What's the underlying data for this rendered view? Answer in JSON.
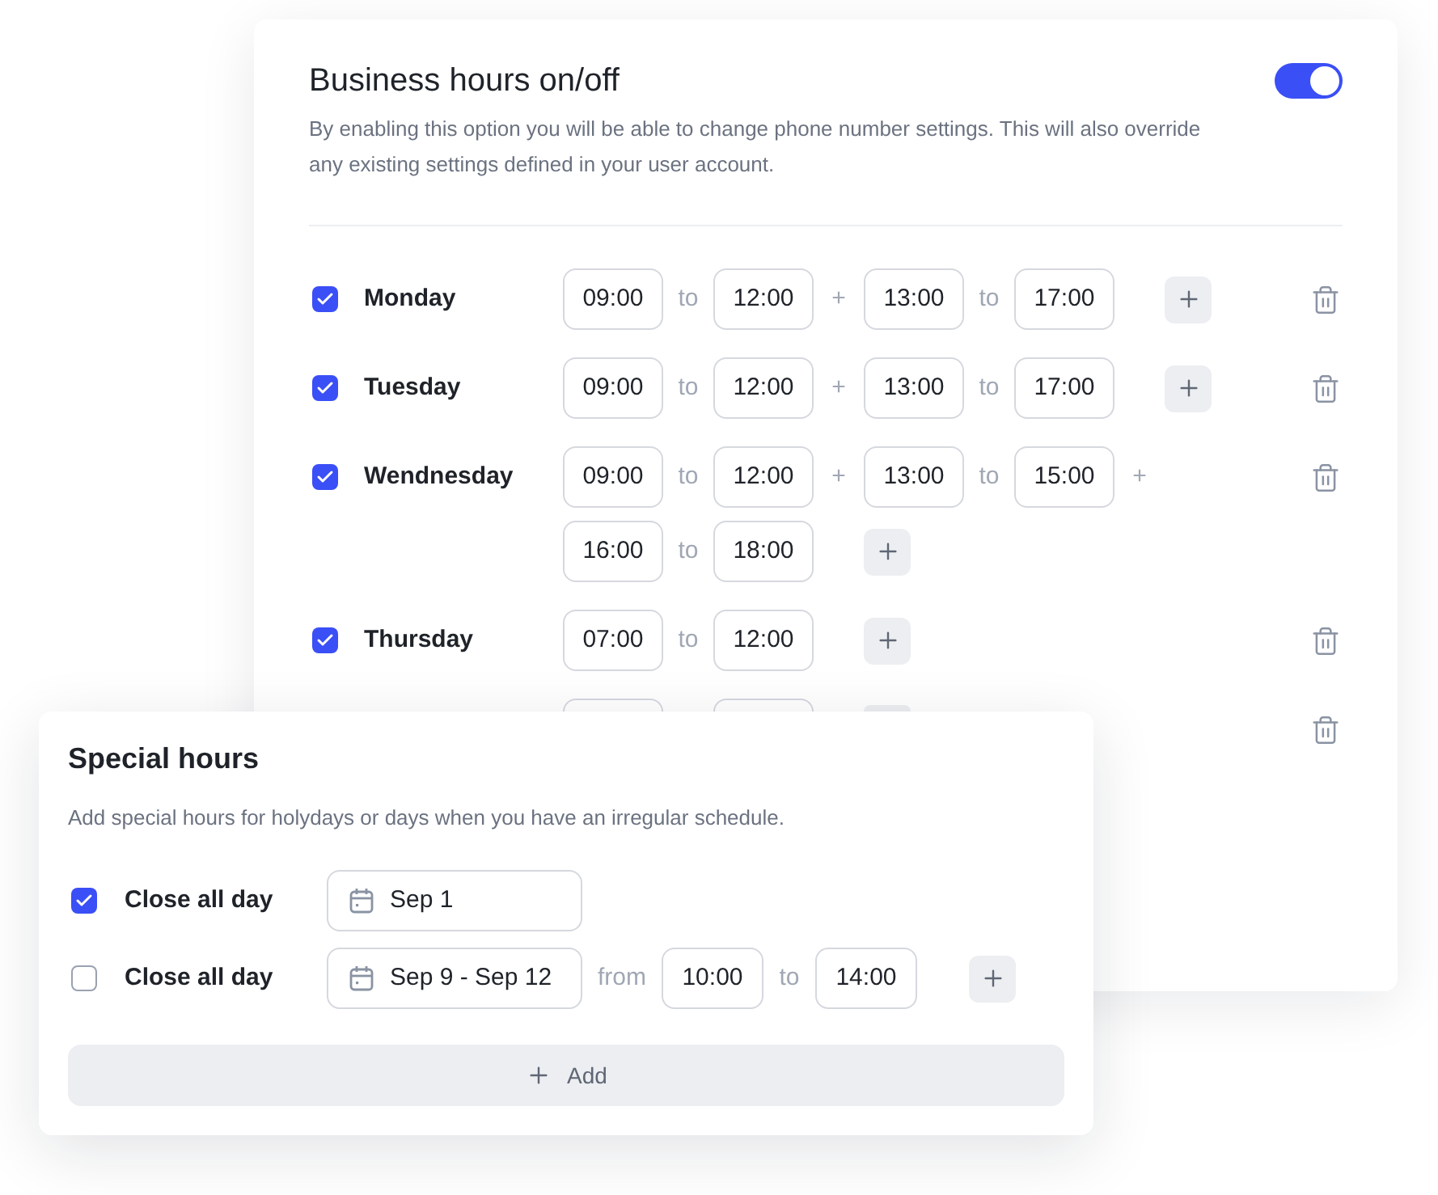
{
  "business_hours": {
    "title": "Business hours on/off",
    "toggle_on": true,
    "description": "By enabling this option you will be able to change phone number settings. This will also override any existing settings defined in your user account.",
    "days": [
      {
        "day": "Monday",
        "checked": true,
        "lines": [
          {
            "ranges": [
              {
                "start": "09:00",
                "joiner": "to",
                "end": "12:00",
                "then": "+"
              },
              {
                "start": "13:00",
                "joiner": "to",
                "end": "17:00"
              }
            ],
            "add_button": true
          }
        ]
      },
      {
        "day": "Tuesday",
        "checked": true,
        "lines": [
          {
            "ranges": [
              {
                "start": "09:00",
                "joiner": "to",
                "end": "12:00",
                "then": "+"
              },
              {
                "start": "13:00",
                "joiner": "to",
                "end": "17:00"
              }
            ],
            "add_button": true
          }
        ]
      },
      {
        "day": "Wendnesday",
        "checked": true,
        "lines": [
          {
            "ranges": [
              {
                "start": "09:00",
                "joiner": "to",
                "end": "12:00",
                "then": "+"
              },
              {
                "start": "13:00",
                "joiner": "to",
                "end": "15:00",
                "then": "+"
              }
            ],
            "add_button": false
          },
          {
            "ranges": [
              {
                "start": "16:00",
                "joiner": "to",
                "end": "18:00"
              }
            ],
            "add_button": true
          }
        ]
      },
      {
        "day": "Thursday",
        "checked": true,
        "lines": [
          {
            "ranges": [
              {
                "start": "07:00",
                "joiner": "to",
                "end": "12:00"
              }
            ],
            "add_button": true
          }
        ]
      }
    ],
    "covered_row": true
  },
  "special_hours": {
    "title": "Special hours",
    "description": "Add special hours for holydays or days when you have an irregular schedule.",
    "rows": [
      {
        "checked": true,
        "label": "Close all day",
        "date": "Sep 1"
      },
      {
        "checked": false,
        "label": "Close all day",
        "date": "Sep 9 - Sep 12",
        "from_label": "from",
        "start": "10:00",
        "joiner": "to",
        "end": "14:00",
        "add_button": true
      }
    ],
    "add_label": "Add"
  }
}
